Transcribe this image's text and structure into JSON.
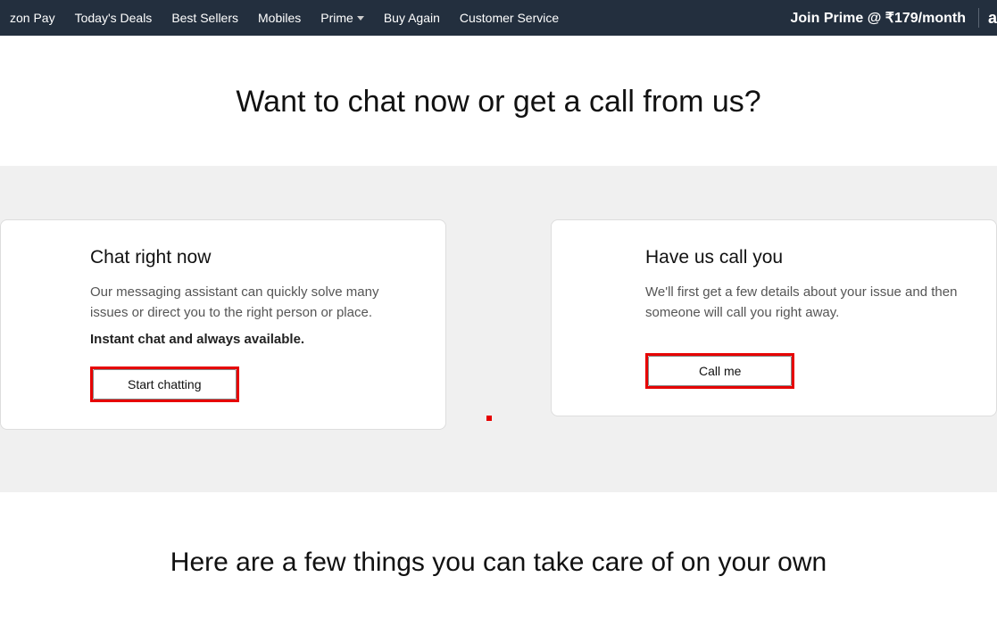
{
  "nav": {
    "items": [
      "zon Pay",
      "Today's Deals",
      "Best Sellers",
      "Mobiles",
      "Prime",
      "Buy Again",
      "Customer Service"
    ],
    "join_prime": "Join Prime @ ₹179/month",
    "logo_fragment": "a"
  },
  "heading": "Want to chat now or get a call from us?",
  "chat_card": {
    "title": "Chat right now",
    "desc": "Our messaging assistant can quickly solve many issues or direct you to the right person or place.",
    "bold": "Instant chat and always available.",
    "button": "Start chatting"
  },
  "call_card": {
    "title": "Have us call you",
    "desc": "We'll first get a few details about your issue and then someone will call you right away.",
    "button": "Call me"
  },
  "sub_heading": "Here are a few things you can take care of on your own"
}
